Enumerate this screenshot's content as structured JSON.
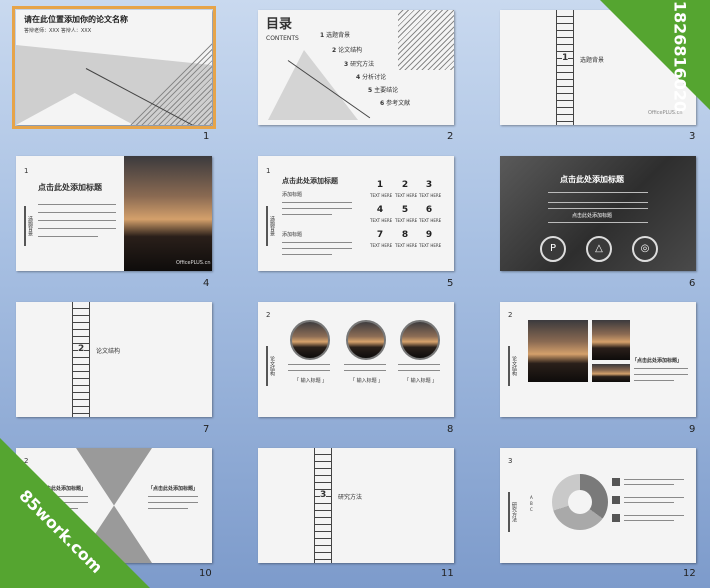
{
  "slides": [
    {
      "index": "1",
      "title": "请在此位置添加你的论文名称",
      "meta": "答辩老师：XXX   答辩人：XXX"
    },
    {
      "index": "2",
      "title": "目录",
      "subtitle": "CONTENTS",
      "items": [
        {
          "n": "1",
          "label": "选题背景"
        },
        {
          "n": "2",
          "label": "论文结构"
        },
        {
          "n": "3",
          "label": "研究方法"
        },
        {
          "n": "4",
          "label": "分析讨论"
        },
        {
          "n": "5",
          "label": "主要结论"
        },
        {
          "n": "6",
          "label": "参考文献"
        }
      ]
    },
    {
      "index": "3",
      "section_num": "1",
      "section_title": "选题背景",
      "brand": "OfficePLUS.cn"
    },
    {
      "index": "4",
      "section_num": "1",
      "heading": "点击此处添加标题",
      "side_label": "选题背景",
      "brand": "OfficePLUS.cn"
    },
    {
      "index": "5",
      "section_num": "1",
      "heading": "点击此处添加标题",
      "sub1": "添加标题",
      "sub2": "添加标题",
      "side_label": "选题背景",
      "grid": [
        "1",
        "2",
        "3",
        "4",
        "5",
        "6",
        "7",
        "8",
        "9"
      ],
      "grid_caption": "TEXT HERE"
    },
    {
      "index": "6",
      "heading": "点击此处添加标题",
      "sub": "点击此处添加标题",
      "icons": [
        "pinterest-icon",
        "playstation-icon",
        "chrome-icon"
      ],
      "icon_glyphs": [
        "P",
        "△",
        "◎"
      ]
    },
    {
      "index": "7",
      "section_num": "2",
      "section_title": "论文结构"
    },
    {
      "index": "8",
      "section_num": "2",
      "side_label": "论文结构",
      "captions": [
        "「 输入标题 」",
        "「 输入标题 」",
        "「 输入标题 」"
      ]
    },
    {
      "index": "9",
      "section_num": "2",
      "side_label": "论文结构",
      "heading": "「点击此处添加标题」"
    },
    {
      "index": "10",
      "section_num": "2",
      "left_heading": "「点击此处添加标题」",
      "right_heading": "「点击此处添加标题」"
    },
    {
      "index": "11",
      "section_num": "3",
      "section_title": "研究方法"
    },
    {
      "index": "12",
      "section_num": "3",
      "side_label": "研究方法",
      "legend": [
        "A",
        "B",
        "C"
      ]
    }
  ],
  "watermarks": {
    "top_right": "qq:1826816020",
    "bottom_left": "85work.com"
  },
  "colors": {
    "selection": "#e6a44a",
    "watermark": "#55a530"
  }
}
